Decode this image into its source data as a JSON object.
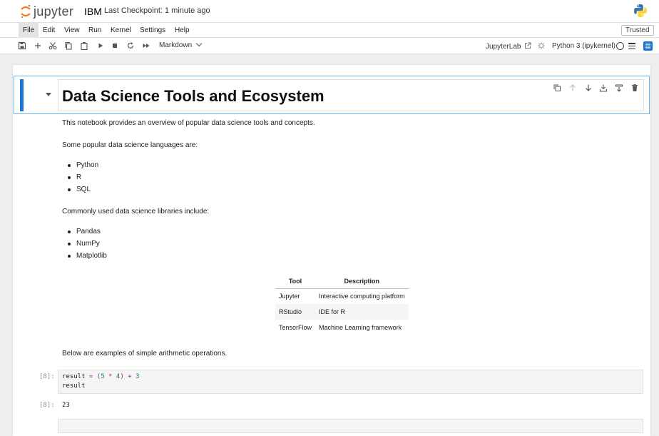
{
  "header": {
    "logo_text": "jupyter",
    "notebook_title": "IBM",
    "checkpoint": "Last Checkpoint: 1 minute ago"
  },
  "menu": [
    "File",
    "Edit",
    "View",
    "Run",
    "Kernel",
    "Settings",
    "Help"
  ],
  "trusted_label": "Trusted",
  "toolbar": {
    "cell_type": "Markdown",
    "jupyterlab_label": "JupyterLab",
    "kernel_name": "Python 3 (ipykernel)"
  },
  "heading": "Data Science Tools and Ecosystem",
  "intro": "This notebook provides an overview of popular data science tools and concepts.",
  "languages_intro": "Some popular data science languages are:",
  "languages": [
    "Python",
    "R",
    "SQL"
  ],
  "libraries_intro": "Commonly used data science libraries include:",
  "libraries": [
    "Pandas",
    "NumPy",
    "Matplotlib"
  ],
  "table": {
    "headers": [
      "Tool",
      "Description"
    ],
    "rows": [
      [
        "Jupyter",
        "Interactive computing platform"
      ],
      [
        "RStudio",
        "IDE for R"
      ],
      [
        "TensorFlow",
        "Machine Learning framework"
      ]
    ]
  },
  "arithmetic_intro": "Below are examples of simple arithmetic operations.",
  "code_cell": {
    "prompt": "[8]:",
    "line1_a": "result",
    "line1_b": " = (",
    "line1_c": "5",
    "line1_d": " * ",
    "line1_e": "4",
    "line1_f": ") + ",
    "line1_g": "3",
    "line2": "result",
    "output_prompt": "[8]:",
    "output": "23"
  },
  "colors": {
    "accent": "#1976d2",
    "logo_orange": "#f37726"
  }
}
